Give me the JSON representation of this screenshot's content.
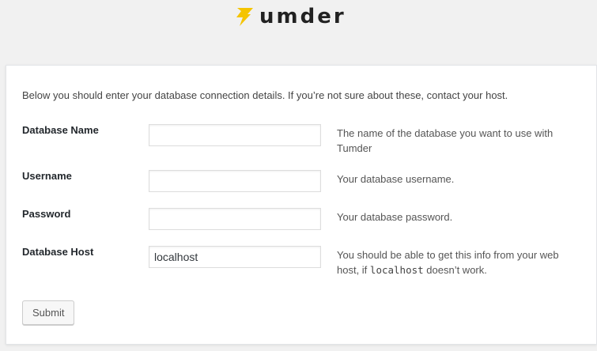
{
  "brand": {
    "logo_text": "umder",
    "accent_color": "#f5c400",
    "icon": "lightning-bolt-icon"
  },
  "form": {
    "intro": "Below you should enter your database connection details. If you’re not sure about these, contact your host.",
    "fields": [
      {
        "label": "Database Name",
        "value": "",
        "help": "The name of the database you want to use with Tumder"
      },
      {
        "label": "Username",
        "value": "",
        "help": "Your database username."
      },
      {
        "label": "Password",
        "value": "",
        "help": "Your database password."
      },
      {
        "label": "Database Host",
        "value": "localhost",
        "help_before": "You should be able to get this info from your web host, if ",
        "help_code": "localhost",
        "help_after": " doesn’t work."
      }
    ],
    "submit_label": "Submit"
  }
}
